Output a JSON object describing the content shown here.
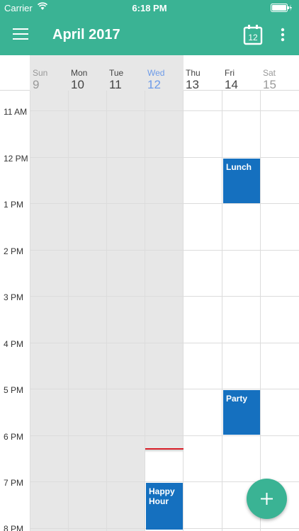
{
  "status_bar": {
    "carrier": "Carrier",
    "time": "6:18 PM"
  },
  "header": {
    "title": "April 2017",
    "today_day": "12"
  },
  "days": [
    {
      "name": "Sun",
      "num": "9"
    },
    {
      "name": "Mon",
      "num": "10"
    },
    {
      "name": "Tue",
      "num": "11"
    },
    {
      "name": "Wed",
      "num": "12"
    },
    {
      "name": "Thu",
      "num": "13"
    },
    {
      "name": "Fri",
      "num": "14"
    },
    {
      "name": "Sat",
      "num": "15"
    }
  ],
  "hours": [
    "11 AM",
    "12 PM",
    "1 PM",
    "2 PM",
    "3 PM",
    "4 PM",
    "5 PM",
    "6 PM",
    "7 PM",
    "8 PM"
  ],
  "events": [
    {
      "title": "Lunch",
      "day": "Fri"
    },
    {
      "title": "Party",
      "day": "Fri"
    },
    {
      "title": "Happy Hour",
      "day": "Wed"
    }
  ],
  "colors": {
    "primary": "#3ab394",
    "event": "#1570bf",
    "today": "#6d9be8",
    "now_line": "#d9202a"
  }
}
